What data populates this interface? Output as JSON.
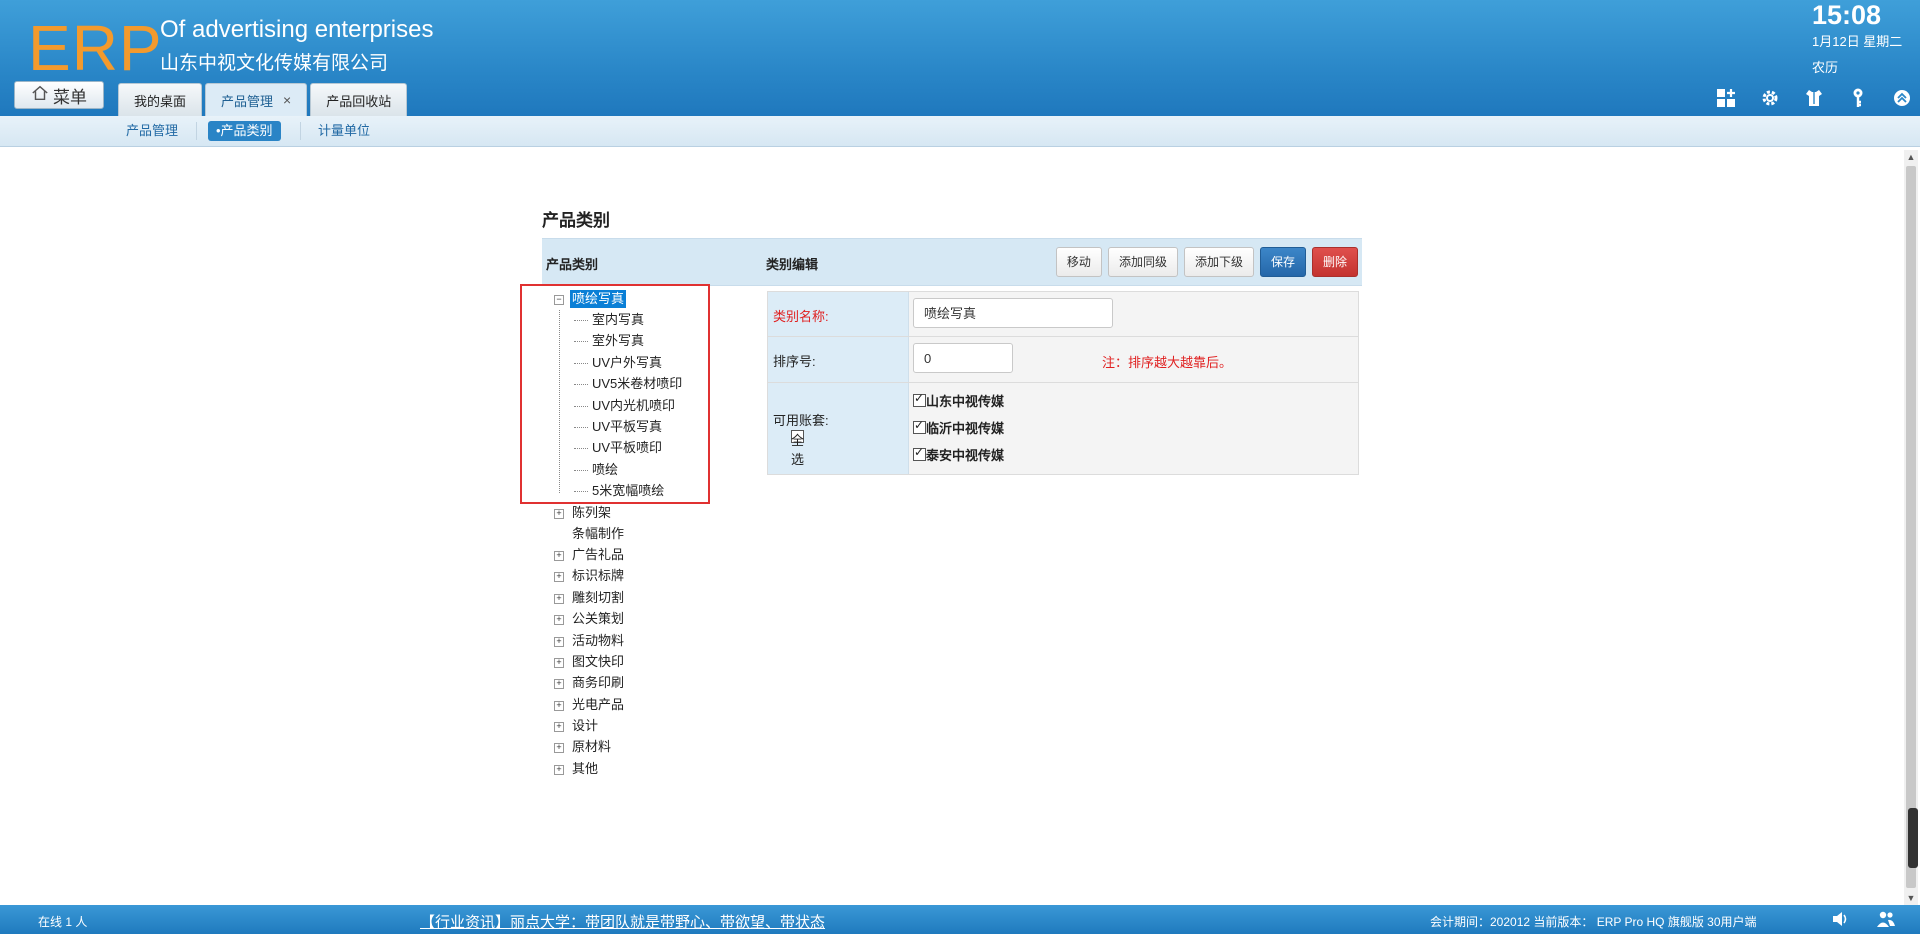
{
  "header": {
    "logo": "ERP",
    "company_en": "Of advertising enterprises",
    "company_cn": "山东中视文化传媒有限公司",
    "time": "15:08",
    "date": "1月12日 星期二",
    "lunar": "农历",
    "menu_label": "菜单",
    "tabs": [
      {
        "label": "我的桌面"
      },
      {
        "label": "产品管理",
        "close": "×"
      },
      {
        "label": "产品回收站"
      }
    ],
    "icons": [
      "grid-add-icon",
      "gear-icon",
      "shirt-icon",
      "key-icon",
      "collapse-up-icon"
    ]
  },
  "subnav": {
    "items": [
      {
        "label": "产品管理"
      },
      {
        "label": "•产品类别"
      },
      {
        "label": "计量单位"
      }
    ]
  },
  "page": {
    "title": "产品类别",
    "left_header": "产品类别",
    "right_header": "类别编辑",
    "buttons": {
      "move": "移动",
      "add_sibling": "添加同级",
      "add_child": "添加下级",
      "save": "保存",
      "delete": "删除"
    }
  },
  "tree": {
    "root_open": {
      "label": "喷绘写真",
      "toggle": "−"
    },
    "children": [
      "室内写真",
      "室外写真",
      "UV户外写真",
      "UV5米卷材喷印",
      "UV内光机喷印",
      "UV平板写真",
      "UV平板喷印",
      "喷绘",
      "5米宽幅喷绘"
    ],
    "collapsed": [
      {
        "label": "陈列架",
        "toggle": "+"
      },
      {
        "label": "条幅制作",
        "toggle": ""
      },
      {
        "label": "广告礼品",
        "toggle": "+"
      },
      {
        "label": "标识标牌",
        "toggle": "+"
      },
      {
        "label": "雕刻切割",
        "toggle": "+"
      },
      {
        "label": "公关策划",
        "toggle": "+"
      },
      {
        "label": "活动物料",
        "toggle": "+"
      },
      {
        "label": "图文快印",
        "toggle": "+"
      },
      {
        "label": "商务印刷",
        "toggle": "+"
      },
      {
        "label": "光电产品",
        "toggle": "+"
      },
      {
        "label": "设计",
        "toggle": "+"
      },
      {
        "label": "原材料",
        "toggle": "+"
      },
      {
        "label": "其他",
        "toggle": "+"
      }
    ]
  },
  "form": {
    "name_label": "类别名称:",
    "name_value": "喷绘写真",
    "sort_label": "排序号:",
    "sort_value": "0",
    "sort_note": "注：排序越大越靠后。",
    "accounts_label": "可用账套:",
    "select_all": "全选",
    "accounts": [
      "山东中视传媒",
      "临沂中视传媒",
      "泰安中视传媒"
    ]
  },
  "footer": {
    "online": "在线  1  人",
    "news": "【行业资讯】丽点大学：带团队就是带野心、带欲望、带状态",
    "period": "会计期间：202012 当前版本：  ERP Pro HQ 旗舰版 30用户端"
  },
  "colors": {
    "header_blue": "#2a87c8",
    "logo_orange": "#f39a2d",
    "selected_node": "#0a7fd6",
    "save_button": "#2567a9",
    "delete_button": "#c43330",
    "required_red": "#e02020"
  }
}
